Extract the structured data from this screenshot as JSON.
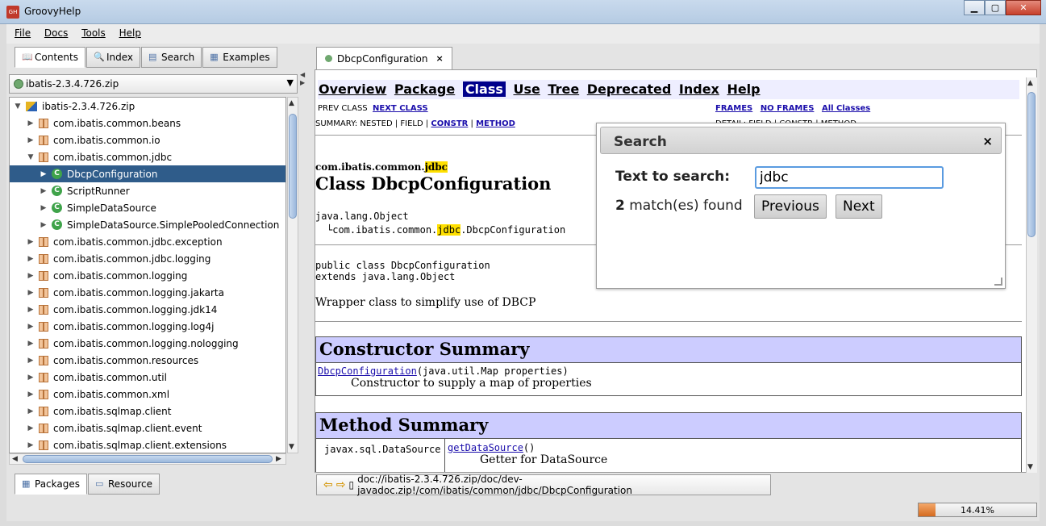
{
  "window": {
    "title": "GroovyHelp",
    "icon_text": "GH"
  },
  "menu": {
    "file": "File",
    "docs": "Docs",
    "tools": "Tools",
    "help": "Help"
  },
  "left_tabs": {
    "contents": "Contents",
    "index": "Index",
    "search": "Search",
    "examples": "Examples"
  },
  "archive_combo": {
    "value": "ibatis-2.3.4.726.zip"
  },
  "tree": [
    {
      "label": "ibatis-2.3.4.726.zip",
      "kind": "jar",
      "level": 0,
      "expanded": true
    },
    {
      "label": "com.ibatis.common.beans",
      "kind": "pkg",
      "level": 1,
      "expanded": false
    },
    {
      "label": "com.ibatis.common.io",
      "kind": "pkg",
      "level": 1,
      "expanded": false
    },
    {
      "label": "com.ibatis.common.jdbc",
      "kind": "pkg",
      "level": 1,
      "expanded": true
    },
    {
      "label": "DbcpConfiguration",
      "kind": "class",
      "level": 2,
      "expanded": false,
      "selected": true
    },
    {
      "label": "ScriptRunner",
      "kind": "class",
      "level": 2
    },
    {
      "label": "SimpleDataSource",
      "kind": "class",
      "level": 2
    },
    {
      "label": "SimpleDataSource.SimplePooledConnection",
      "kind": "class",
      "level": 2
    },
    {
      "label": "com.ibatis.common.jdbc.exception",
      "kind": "pkg",
      "level": 1
    },
    {
      "label": "com.ibatis.common.jdbc.logging",
      "kind": "pkg",
      "level": 1
    },
    {
      "label": "com.ibatis.common.logging",
      "kind": "pkg",
      "level": 1
    },
    {
      "label": "com.ibatis.common.logging.jakarta",
      "kind": "pkg",
      "level": 1
    },
    {
      "label": "com.ibatis.common.logging.jdk14",
      "kind": "pkg",
      "level": 1
    },
    {
      "label": "com.ibatis.common.logging.log4j",
      "kind": "pkg",
      "level": 1
    },
    {
      "label": "com.ibatis.common.logging.nologging",
      "kind": "pkg",
      "level": 1
    },
    {
      "label": "com.ibatis.common.resources",
      "kind": "pkg",
      "level": 1
    },
    {
      "label": "com.ibatis.common.util",
      "kind": "pkg",
      "level": 1
    },
    {
      "label": "com.ibatis.common.xml",
      "kind": "pkg",
      "level": 1
    },
    {
      "label": "com.ibatis.sqlmap.client",
      "kind": "pkg",
      "level": 1
    },
    {
      "label": "com.ibatis.sqlmap.client.event",
      "kind": "pkg",
      "level": 1
    },
    {
      "label": "com.ibatis.sqlmap.client.extensions",
      "kind": "pkg",
      "level": 1
    }
  ],
  "bottom_tabs": {
    "packages": "Packages",
    "resource": "Resource"
  },
  "doc_tab": {
    "label": "DbcpConfiguration"
  },
  "doc": {
    "nav": {
      "overview": "Overview",
      "package": "Package",
      "class": "Class",
      "use": "Use",
      "tree": "Tree",
      "deprecated": "Deprecated",
      "index": "Index",
      "help": "Help"
    },
    "prev_class": "PREV CLASS",
    "next_class": "NEXT CLASS",
    "frames": "FRAMES",
    "no_frames": "NO FRAMES",
    "all_classes": "All Classes",
    "summary_prefix": "SUMMARY: NESTED | FIELD | ",
    "summary_constr": "CONSTR",
    "summary_sep": " | ",
    "summary_method": "METHOD",
    "detail_partial": "DETAIL: FIELD | CONSTR | METHOD",
    "package_prefix": "com.ibatis.common.",
    "package_hl": "jdbc",
    "class_title": "Class DbcpConfiguration",
    "hier_root": "java.lang.Object",
    "hier_child_prefix": "com.ibatis.common.",
    "hier_child_hl": "jdbc",
    "hier_child_suffix": ".DbcpConfiguration",
    "decl_line1": "public class DbcpConfiguration",
    "decl_line2": "extends java.lang.Object",
    "description": "Wrapper class to simplify use of DBCP",
    "constructor_summary": "Constructor Summary",
    "ctor_name": "DbcpConfiguration",
    "ctor_params": "(java.util.Map properties)",
    "ctor_desc": "Constructor to supply a map of properties",
    "method_summary": "Method Summary",
    "method_type": "javax.sql.DataSource",
    "method_name": "getDataSource",
    "method_params": "()",
    "method_desc": "Getter for DataSource"
  },
  "address": {
    "path": "doc://ibatis-2.3.4.726.zip/doc/dev-javadoc.zip!/com/ibatis/common/jdbc/DbcpConfiguration"
  },
  "status": {
    "progress_text": "14.41%",
    "progress_value": 0.1441,
    "progress_color": "#e07a2a"
  },
  "search_dialog": {
    "title": "Search",
    "close": "×",
    "label": "Text to search:",
    "query": "jdbc",
    "count": "2",
    "count_suffix": " match(es) found",
    "previous": "Previous",
    "next": "Next"
  }
}
